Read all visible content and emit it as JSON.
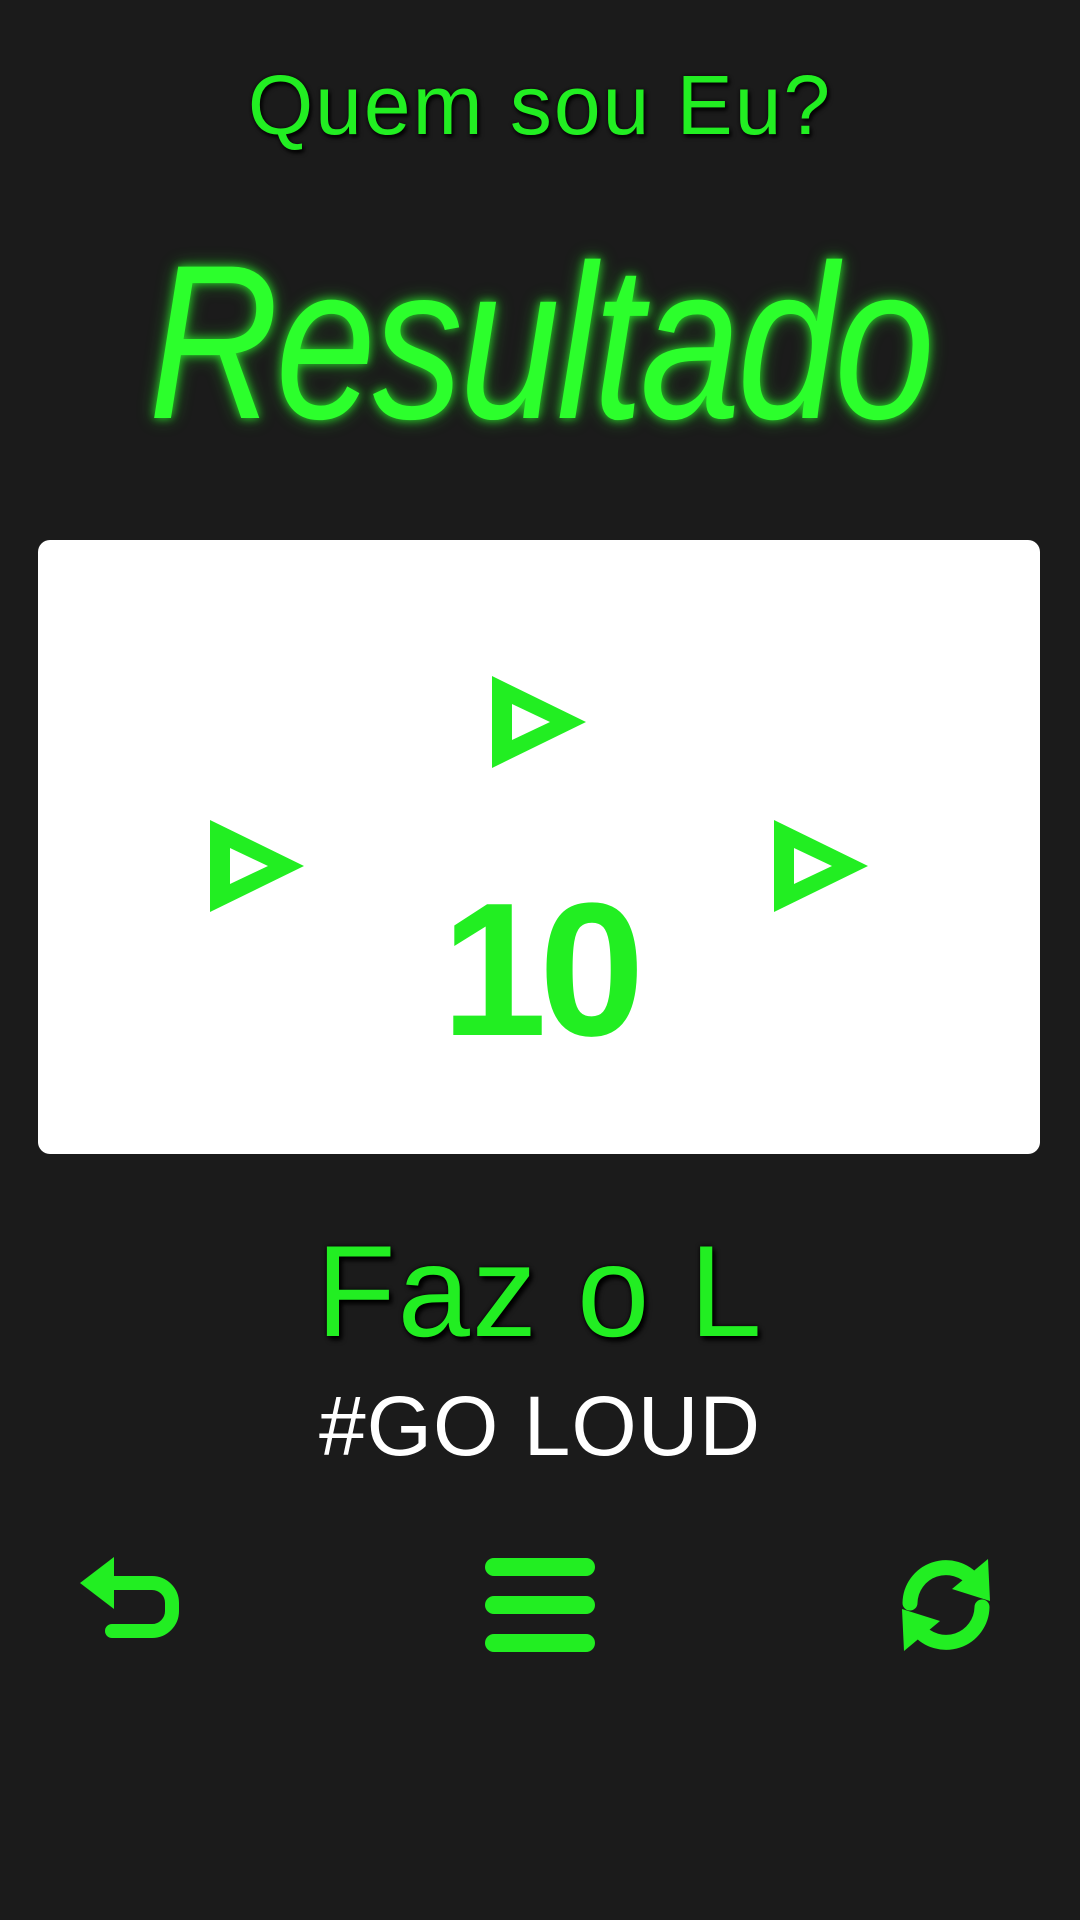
{
  "header": {
    "app_title": "Quem sou Eu?",
    "result_heading": "Resultado"
  },
  "score_card": {
    "score": "10",
    "markers": [
      "play-icon",
      "play-icon",
      "play-icon"
    ]
  },
  "rank": {
    "title": "Faz o L",
    "tagline": "#GO LOUD"
  },
  "controls": {
    "icons": [
      "undo-icon",
      "menu-icon",
      "refresh-icon"
    ]
  },
  "colors": {
    "background": "#1b1b1b",
    "accent_green": "#22ee22",
    "card_background": "#ffffff",
    "tagline_text": "#ffffff"
  }
}
